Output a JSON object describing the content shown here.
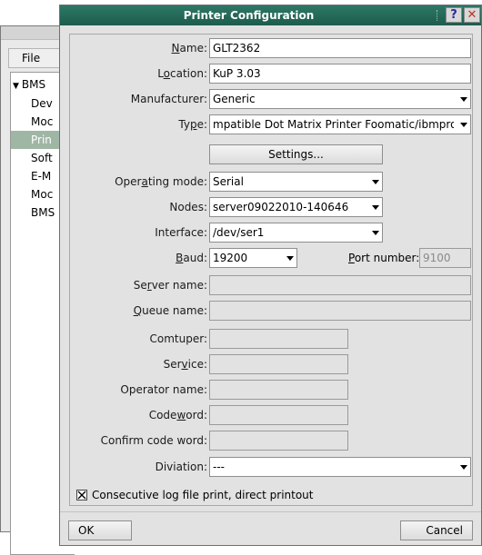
{
  "background_app": {
    "menu_file": "File",
    "tree": [
      {
        "label": "BMS",
        "expanded": true,
        "selected": false
      },
      {
        "label": "Dev",
        "selected": false
      },
      {
        "label": "Moc",
        "selected": false
      },
      {
        "label": "Prin",
        "selected": true
      },
      {
        "label": "Soft",
        "selected": false
      },
      {
        "label": "E-M",
        "selected": false
      },
      {
        "label": "Moc",
        "selected": false
      },
      {
        "label": "BMS",
        "selected": false
      }
    ]
  },
  "dialog": {
    "title": "Printer Configuration",
    "help_glyph": "?",
    "close_glyph": "✕",
    "fields": {
      "name": {
        "label_pre": "",
        "label_u": "N",
        "label_post": "ame:",
        "value": "GLT2362"
      },
      "location": {
        "label_pre": "L",
        "label_u": "o",
        "label_post": "cation:",
        "value": "KuP 3.03"
      },
      "manufacturer": {
        "label": "Manufacturer:",
        "value": "Generic"
      },
      "type": {
        "label_pre": "Ty",
        "label_u": "p",
        "label_post": "e:",
        "value": "mpatible Dot Matrix Printer Foomatic/ibmpro"
      },
      "settings_button": "Settings...",
      "operating_mode": {
        "label_pre": "Oper",
        "label_u": "a",
        "label_post": "ting mode:",
        "value": "Serial"
      },
      "nodes": {
        "label": "Nodes:",
        "value": "server09022010-140646"
      },
      "interface": {
        "label": "Interface:",
        "value": "/dev/ser1"
      },
      "baud": {
        "label_pre": "",
        "label_u": "B",
        "label_post": "aud:",
        "value": "19200"
      },
      "port_number": {
        "label_pre": "",
        "label_u": "P",
        "label_post": "ort number:",
        "value": "9100"
      },
      "server_name": {
        "label_pre": "Se",
        "label_u": "r",
        "label_post": "ver name:",
        "value": ""
      },
      "queue_name": {
        "label_pre": "",
        "label_u": "Q",
        "label_post": "ueue name:",
        "value": ""
      },
      "comtuper": {
        "label": "Comtuper:",
        "value": ""
      },
      "service": {
        "label_pre": "Ser",
        "label_u": "v",
        "label_post": "ice:",
        "value": ""
      },
      "operator_name": {
        "label": "Operator name:",
        "value": ""
      },
      "codeword": {
        "label_pre": "Code",
        "label_u": "w",
        "label_post": "ord:",
        "value": ""
      },
      "confirm_code_word": {
        "label": "Confirm code word:",
        "value": ""
      },
      "diviation": {
        "label": "Diviation:",
        "value": "---"
      }
    },
    "consecutive_checkbox": {
      "label": "Consecutive log file print, direct printout",
      "checked": true
    },
    "ok_button": "OK",
    "cancel_button": "Cancel"
  },
  "colors": {
    "titlebar": "#1d5c4c",
    "selection": "#9fb6a5"
  }
}
